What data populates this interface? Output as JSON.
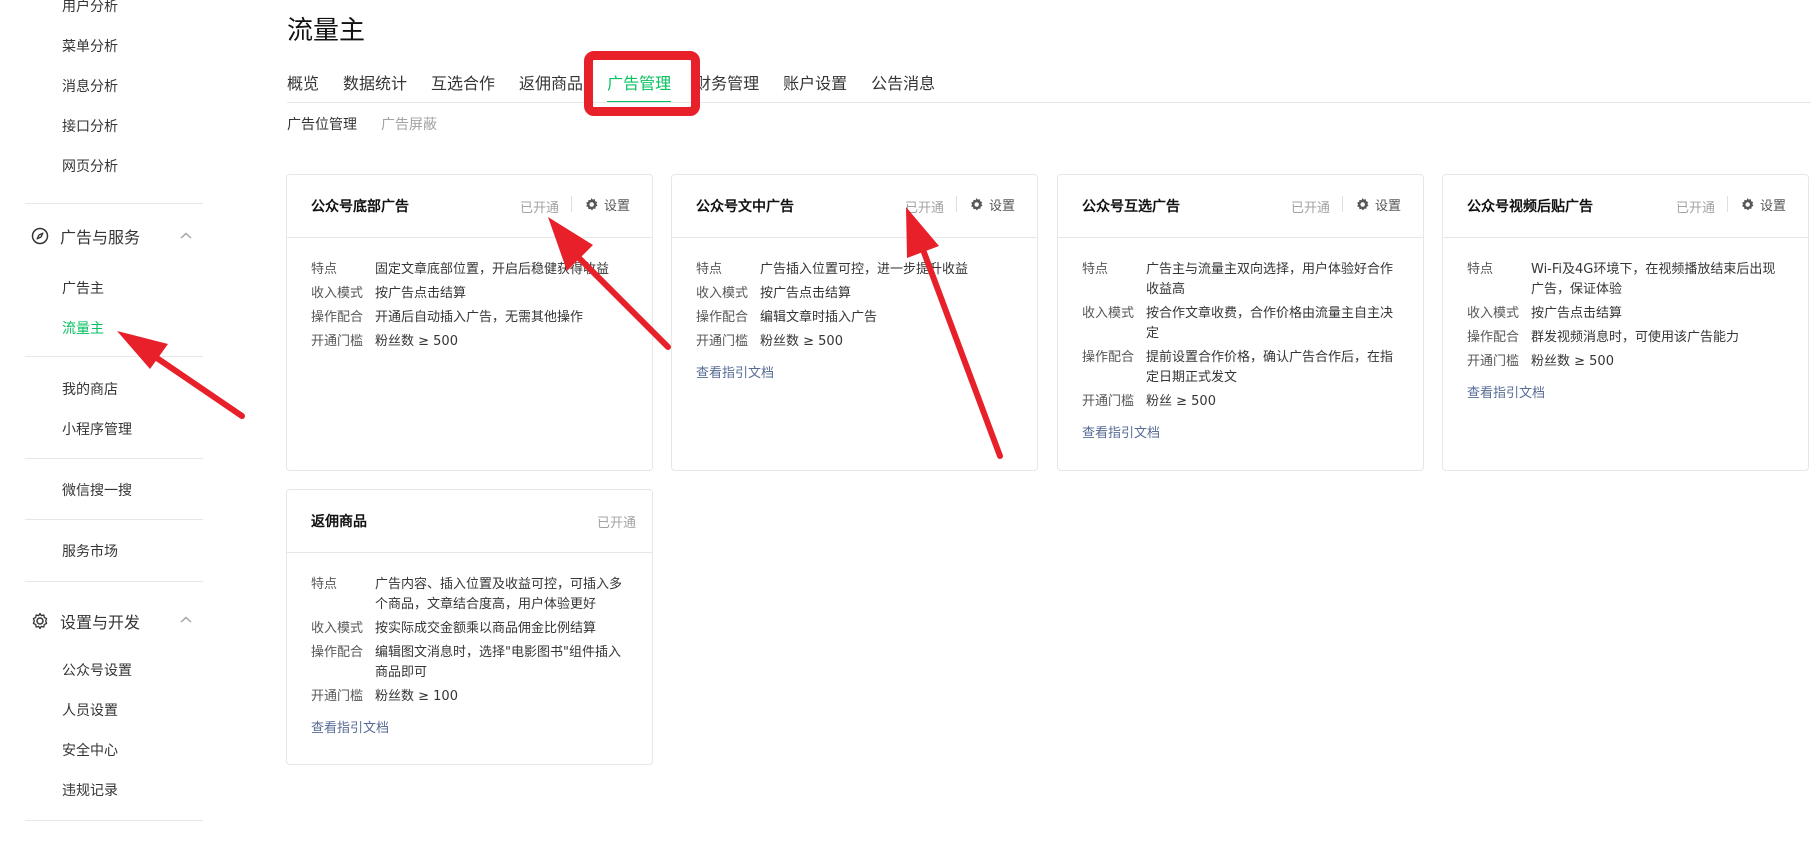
{
  "sidebar": {
    "items_top": [
      "用户分析",
      "菜单分析",
      "消息分析",
      "接口分析",
      "网页分析"
    ],
    "group_ads": {
      "label": "广告与服务",
      "icon": "compass-icon"
    },
    "ads_items": [
      "广告主",
      "流量主"
    ],
    "shop_items": [
      "我的商店",
      "小程序管理"
    ],
    "search_item": "微信搜一搜",
    "market_item": "服务市场",
    "group_dev": {
      "label": "设置与开发",
      "icon": "gear-icon"
    },
    "dev_items": [
      "公众号设置",
      "人员设置",
      "安全中心",
      "违规记录"
    ]
  },
  "page": {
    "title": "流量主"
  },
  "tabs": [
    "概览",
    "数据统计",
    "互选合作",
    "返佣商品",
    "广告管理",
    "财务管理",
    "账户设置",
    "公告消息"
  ],
  "active_tab": "广告管理",
  "subtabs": [
    "广告位管理",
    "广告屏蔽"
  ],
  "labels": {
    "feature": "特点",
    "income": "收入模式",
    "operation": "操作配合",
    "threshold": "开通门槛",
    "doc_link": "查看指引文档",
    "status": "已开通",
    "settings": "设置"
  },
  "cards": [
    {
      "title": "公众号底部广告",
      "feature": "固定文章底部位置，开启后稳健获得收益",
      "income": "按广告点击结算",
      "operation": "开通后自动插入广告，无需其他操作",
      "threshold": "粉丝数 ≥ 500"
    },
    {
      "title": "公众号文中广告",
      "feature": "广告插入位置可控，进一步提升收益",
      "income": "按广告点击结算",
      "operation": "编辑文章时插入广告",
      "threshold": "粉丝数 ≥ 500"
    },
    {
      "title": "公众号互选广告",
      "feature": "广告主与流量主双向选择，用户体验好合作收益高",
      "income": "按合作文章收费，合作价格由流量主自主决定",
      "operation": "提前设置合作价格，确认广告合作后，在指定日期正式发文",
      "threshold": "粉丝 ≥ 500"
    },
    {
      "title": "公众号视频后贴广告",
      "feature": "Wi-Fi及4G环境下，在视频播放结束后出现广告，保证体验",
      "income": "按广告点击结算",
      "operation": "群发视频消息时，可使用该广告能力",
      "threshold": "粉丝数 ≥ 500"
    },
    {
      "title": "返佣商品",
      "feature": "广告内容、插入位置及收益可控，可插入多个商品，文章结合度高，用户体验更好",
      "income": "按实际成交金额乘以商品佣金比例结算",
      "operation": "编辑图文消息时，选择\"电影图书\"组件插入商品即可",
      "threshold": "粉丝数 ≥ 100"
    }
  ],
  "colors": {
    "accent": "#07c160",
    "link": "#576b95",
    "annotation": "#e8202a"
  }
}
